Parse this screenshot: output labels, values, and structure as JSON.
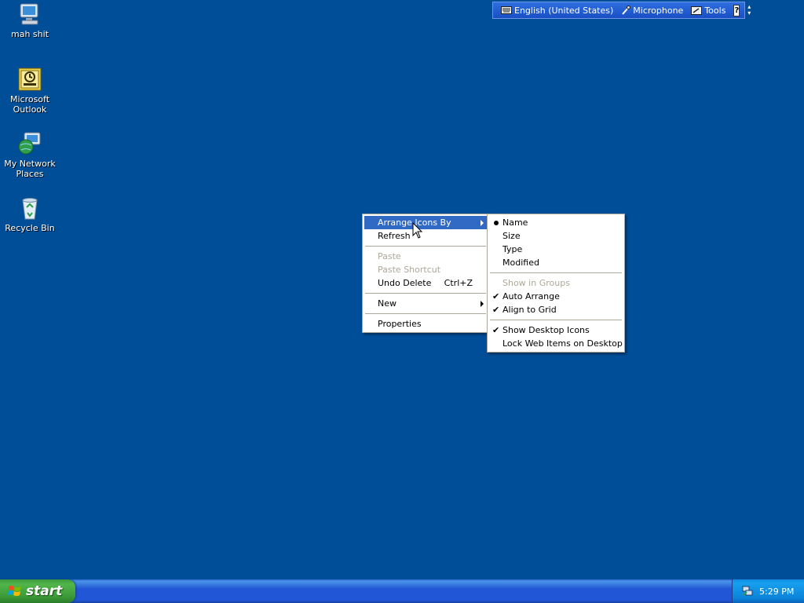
{
  "desktop": {
    "icons": [
      {
        "label": "mah shit"
      },
      {
        "label": "Microsoft Outlook"
      },
      {
        "label": "My Network Places"
      },
      {
        "label": "Recycle Bin"
      }
    ]
  },
  "language_bar": {
    "language": "English (United States)",
    "microphone": "Microphone",
    "tools": "Tools",
    "help": "?"
  },
  "context_menu": {
    "arrange_icons_by": "Arrange Icons By",
    "refresh": "Refresh",
    "paste": "Paste",
    "paste_shortcut": "Paste Shortcut",
    "undo_delete": "Undo Delete",
    "undo_delete_shortcut": "Ctrl+Z",
    "new": "New",
    "properties": "Properties"
  },
  "arrange_submenu": {
    "name": "Name",
    "size": "Size",
    "type": "Type",
    "modified": "Modified",
    "show_in_groups": "Show in Groups",
    "auto_arrange": "Auto Arrange",
    "align_to_grid": "Align to Grid",
    "show_desktop_icons": "Show Desktop Icons",
    "lock_web_items": "Lock Web Items on Desktop"
  },
  "taskbar": {
    "start_label": "start",
    "clock": "5:29 PM"
  },
  "colors": {
    "desktop_bg": "#004e98",
    "menu_highlight": "#316ac5",
    "taskbar": "#2157d7",
    "start_button": "#3d9c38"
  }
}
